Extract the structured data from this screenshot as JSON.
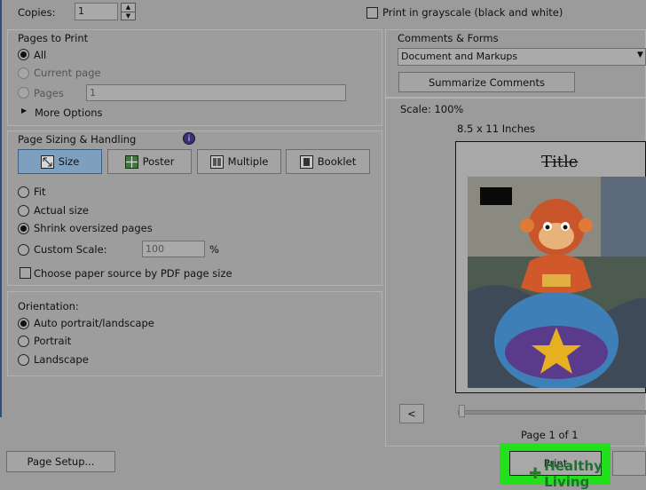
{
  "copies": {
    "label": "Copies:",
    "value": "1"
  },
  "grayscale": {
    "label": "Print in grayscale (black and white)"
  },
  "pages_to_print": {
    "title": "Pages to Print",
    "all": "All",
    "current_page": "Current page",
    "pages": "Pages",
    "pages_value": "1",
    "more_options": "More Options"
  },
  "sizing": {
    "title": "Page Sizing & Handling",
    "size": "Size",
    "poster": "Poster",
    "multiple": "Multiple",
    "booklet": "Booklet",
    "fit": "Fit",
    "actual_size": "Actual size",
    "shrink": "Shrink oversized pages",
    "custom_scale": "Custom Scale:",
    "custom_scale_value": "100",
    "percent": "%",
    "choose_paper": "Choose paper source by PDF page size"
  },
  "orientation": {
    "title": "Orientation:",
    "auto": "Auto portrait/landscape",
    "portrait": "Portrait",
    "landscape": "Landscape"
  },
  "comments": {
    "title": "Comments & Forms",
    "selected": "Document and Markups",
    "summarize": "Summarize Comments"
  },
  "preview": {
    "scale": "Scale: 100%",
    "paper_size": "8.5 x 11 Inches",
    "doc_title": "Title",
    "page_label": "Page 1 of 1",
    "prev": "<"
  },
  "footer": {
    "page_setup": "Page Setup...",
    "print": "Print"
  },
  "watermark": {
    "brand": "Healthy Living"
  },
  "colors": {
    "highlight": "#22e01c",
    "selected_button": "#7f9fbf"
  }
}
